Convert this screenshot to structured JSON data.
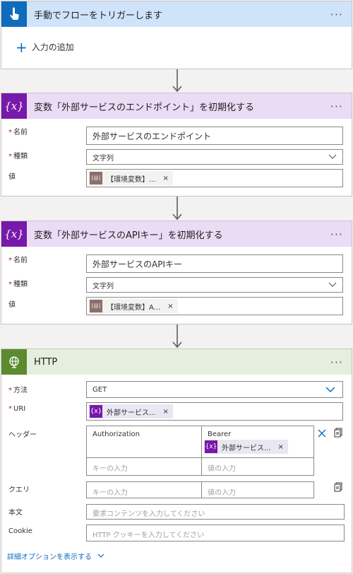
{
  "trigger": {
    "title": "手動でフローをトリガーします",
    "menu": "···",
    "add_input": "入力の追加",
    "color": "#0f6cbd"
  },
  "var1": {
    "title": "変数「外部サービスのエンドポイント」を初期化する",
    "menu": "···",
    "name_label": "名前",
    "name_value": "外部サービスのエンドポイント",
    "type_label": "種類",
    "type_value": "文字列",
    "value_label": "値",
    "value_token": "【環境変数】...",
    "token_close": "×",
    "token_icon": "[@]",
    "color": "#7719aa"
  },
  "var2": {
    "title": "変数「外部サービスのAPIキー」を初期化する",
    "menu": "···",
    "name_label": "名前",
    "name_value": "外部サービスのAPIキー",
    "type_label": "種類",
    "type_value": "文字列",
    "value_label": "値",
    "value_token": "【環境変数】A...",
    "token_close": "×",
    "token_icon": "[@]"
  },
  "http": {
    "title": "HTTP",
    "menu": "···",
    "method_label": "方法",
    "method_value": "GET",
    "uri_label": "URI",
    "uri_token": "外部サービス...",
    "token_close": "×",
    "token_icon": "{x}",
    "headers_label": "ヘッダー",
    "header_key": "Authorization",
    "header_value_text": "Bearer",
    "header_value_token": "外部サービス...",
    "key_placeholder": "キーの入力",
    "value_placeholder": "値の入力",
    "query_label": "クエリ",
    "body_label": "本文",
    "body_placeholder": "要求コンテンツを入力してください",
    "cookie_label": "Cookie",
    "cookie_placeholder": "HTTP クッキーを入力してください",
    "advanced_link": "詳細オプションを表示する",
    "color": "#5c8a2e"
  }
}
